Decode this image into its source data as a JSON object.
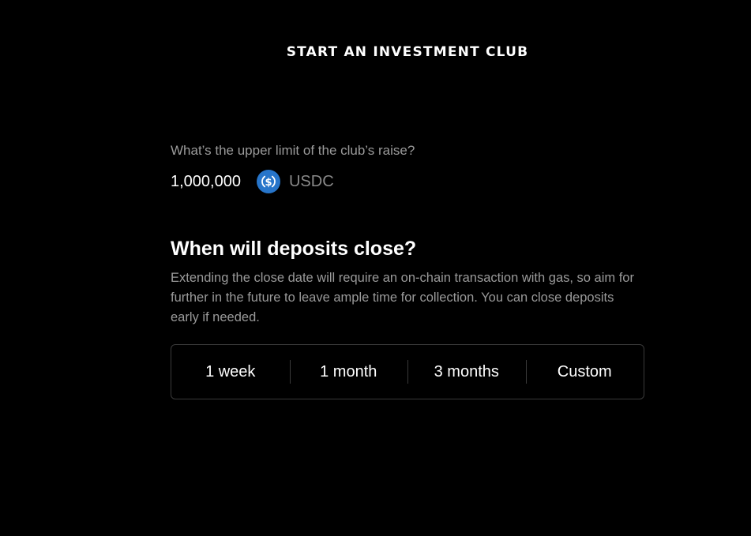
{
  "header": {
    "title": "START AN INVESTMENT CLUB"
  },
  "raise_limit": {
    "question": "What’s the upper limit of the club’s raise?",
    "amount": "1,000,000",
    "currency_icon": "usdc-coin-icon",
    "currency": "USDC"
  },
  "deposits": {
    "heading": "When will deposits close?",
    "description": "Extending the close date will require an on-chain transaction with gas, so aim for further in the future to leave ample time for collection. You can close deposits early if needed.",
    "options": [
      {
        "label": "1 week"
      },
      {
        "label": "1 month"
      },
      {
        "label": "3 months"
      },
      {
        "label": "Custom"
      }
    ]
  },
  "colors": {
    "background": "#000000",
    "usdc_blue": "#2775CA",
    "muted_text": "#9a9a9a",
    "border": "#3a3a3a"
  }
}
